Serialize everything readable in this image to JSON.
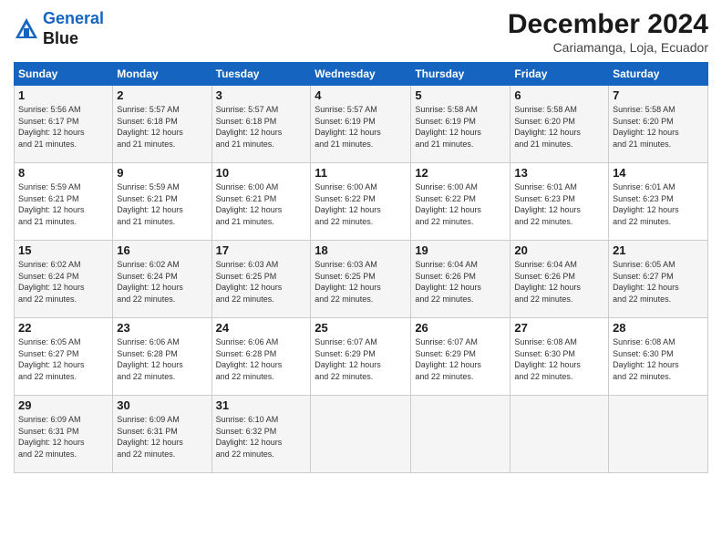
{
  "header": {
    "logo_line1": "General",
    "logo_line2": "Blue",
    "month": "December 2024",
    "location": "Cariamanga, Loja, Ecuador"
  },
  "weekdays": [
    "Sunday",
    "Monday",
    "Tuesday",
    "Wednesday",
    "Thursday",
    "Friday",
    "Saturday"
  ],
  "weeks": [
    [
      {
        "day": "1",
        "info": "Sunrise: 5:56 AM\nSunset: 6:17 PM\nDaylight: 12 hours\nand 21 minutes."
      },
      {
        "day": "2",
        "info": "Sunrise: 5:57 AM\nSunset: 6:18 PM\nDaylight: 12 hours\nand 21 minutes."
      },
      {
        "day": "3",
        "info": "Sunrise: 5:57 AM\nSunset: 6:18 PM\nDaylight: 12 hours\nand 21 minutes."
      },
      {
        "day": "4",
        "info": "Sunrise: 5:57 AM\nSunset: 6:19 PM\nDaylight: 12 hours\nand 21 minutes."
      },
      {
        "day": "5",
        "info": "Sunrise: 5:58 AM\nSunset: 6:19 PM\nDaylight: 12 hours\nand 21 minutes."
      },
      {
        "day": "6",
        "info": "Sunrise: 5:58 AM\nSunset: 6:20 PM\nDaylight: 12 hours\nand 21 minutes."
      },
      {
        "day": "7",
        "info": "Sunrise: 5:58 AM\nSunset: 6:20 PM\nDaylight: 12 hours\nand 21 minutes."
      }
    ],
    [
      {
        "day": "8",
        "info": "Sunrise: 5:59 AM\nSunset: 6:21 PM\nDaylight: 12 hours\nand 21 minutes."
      },
      {
        "day": "9",
        "info": "Sunrise: 5:59 AM\nSunset: 6:21 PM\nDaylight: 12 hours\nand 21 minutes."
      },
      {
        "day": "10",
        "info": "Sunrise: 6:00 AM\nSunset: 6:21 PM\nDaylight: 12 hours\nand 21 minutes."
      },
      {
        "day": "11",
        "info": "Sunrise: 6:00 AM\nSunset: 6:22 PM\nDaylight: 12 hours\nand 22 minutes."
      },
      {
        "day": "12",
        "info": "Sunrise: 6:00 AM\nSunset: 6:22 PM\nDaylight: 12 hours\nand 22 minutes."
      },
      {
        "day": "13",
        "info": "Sunrise: 6:01 AM\nSunset: 6:23 PM\nDaylight: 12 hours\nand 22 minutes."
      },
      {
        "day": "14",
        "info": "Sunrise: 6:01 AM\nSunset: 6:23 PM\nDaylight: 12 hours\nand 22 minutes."
      }
    ],
    [
      {
        "day": "15",
        "info": "Sunrise: 6:02 AM\nSunset: 6:24 PM\nDaylight: 12 hours\nand 22 minutes."
      },
      {
        "day": "16",
        "info": "Sunrise: 6:02 AM\nSunset: 6:24 PM\nDaylight: 12 hours\nand 22 minutes."
      },
      {
        "day": "17",
        "info": "Sunrise: 6:03 AM\nSunset: 6:25 PM\nDaylight: 12 hours\nand 22 minutes."
      },
      {
        "day": "18",
        "info": "Sunrise: 6:03 AM\nSunset: 6:25 PM\nDaylight: 12 hours\nand 22 minutes."
      },
      {
        "day": "19",
        "info": "Sunrise: 6:04 AM\nSunset: 6:26 PM\nDaylight: 12 hours\nand 22 minutes."
      },
      {
        "day": "20",
        "info": "Sunrise: 6:04 AM\nSunset: 6:26 PM\nDaylight: 12 hours\nand 22 minutes."
      },
      {
        "day": "21",
        "info": "Sunrise: 6:05 AM\nSunset: 6:27 PM\nDaylight: 12 hours\nand 22 minutes."
      }
    ],
    [
      {
        "day": "22",
        "info": "Sunrise: 6:05 AM\nSunset: 6:27 PM\nDaylight: 12 hours\nand 22 minutes."
      },
      {
        "day": "23",
        "info": "Sunrise: 6:06 AM\nSunset: 6:28 PM\nDaylight: 12 hours\nand 22 minutes."
      },
      {
        "day": "24",
        "info": "Sunrise: 6:06 AM\nSunset: 6:28 PM\nDaylight: 12 hours\nand 22 minutes."
      },
      {
        "day": "25",
        "info": "Sunrise: 6:07 AM\nSunset: 6:29 PM\nDaylight: 12 hours\nand 22 minutes."
      },
      {
        "day": "26",
        "info": "Sunrise: 6:07 AM\nSunset: 6:29 PM\nDaylight: 12 hours\nand 22 minutes."
      },
      {
        "day": "27",
        "info": "Sunrise: 6:08 AM\nSunset: 6:30 PM\nDaylight: 12 hours\nand 22 minutes."
      },
      {
        "day": "28",
        "info": "Sunrise: 6:08 AM\nSunset: 6:30 PM\nDaylight: 12 hours\nand 22 minutes."
      }
    ],
    [
      {
        "day": "29",
        "info": "Sunrise: 6:09 AM\nSunset: 6:31 PM\nDaylight: 12 hours\nand 22 minutes."
      },
      {
        "day": "30",
        "info": "Sunrise: 6:09 AM\nSunset: 6:31 PM\nDaylight: 12 hours\nand 22 minutes."
      },
      {
        "day": "31",
        "info": "Sunrise: 6:10 AM\nSunset: 6:32 PM\nDaylight: 12 hours\nand 22 minutes."
      },
      {
        "day": "",
        "info": ""
      },
      {
        "day": "",
        "info": ""
      },
      {
        "day": "",
        "info": ""
      },
      {
        "day": "",
        "info": ""
      }
    ]
  ]
}
